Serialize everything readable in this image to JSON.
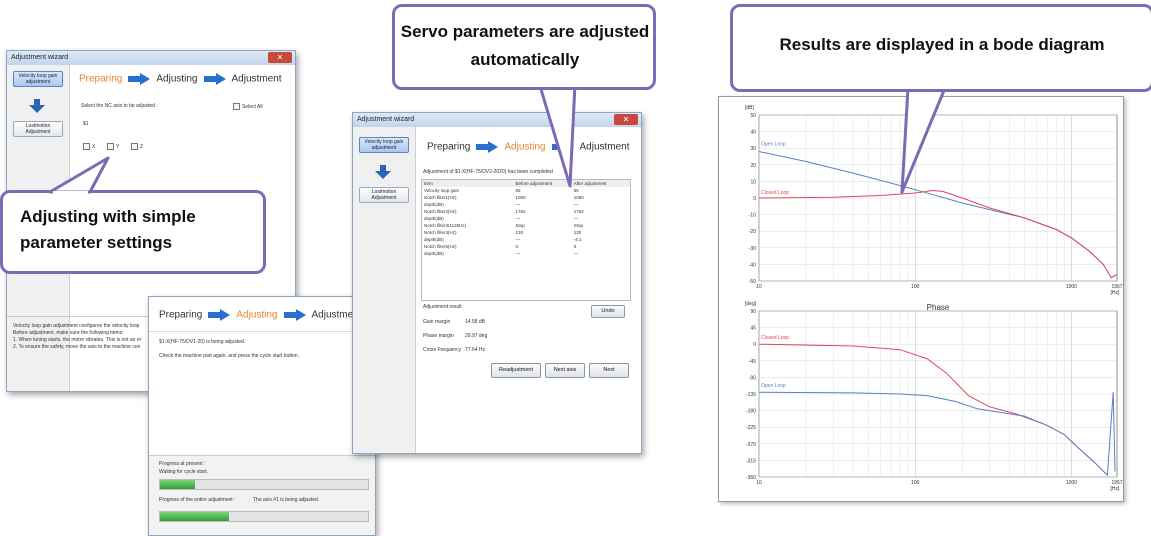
{
  "callouts": {
    "simple": "Adjusting with simple parameter settings",
    "auto": "Servo parameters are adjusted automatically",
    "bode": "Results are displayed in a bode diagram"
  },
  "steps": {
    "preparing": "Preparing",
    "adjusting": "Adjusting",
    "adjustment": "Adjustment"
  },
  "win1": {
    "title": "Adjustment wizard",
    "nav_velocity": "Velocity loop gain adjustment",
    "nav_lost": "Lostmotion Adjustment",
    "select_label": "Select the NC axis to be adjusted.",
    "select_all": "Select All",
    "system": "$1",
    "axes": [
      "X",
      "Y",
      "Z"
    ],
    "footer_lines": [
      "Velocity loop gain adjustment configures the velocity loop",
      "Before adjustment, make sure the following items:",
      "1. When tuning starts, the motor vibrates. This is not an er",
      "2. To ensure the safety, move the axis to the machine cen"
    ]
  },
  "win2": {
    "status": "$1:X(HF-75/DV1-20) is being adjusted.",
    "instruction": "Check the machine part again, and press the cycle start button.",
    "progress_label": "Progress at present :",
    "progress_status": "Waiting for cycle start.",
    "progress_present": 0.17,
    "progress_entire_label": "Progress of the entire adjustment :",
    "progress_entire_status": "The axis #1 is being adjusted.",
    "progress_entire": 0.33
  },
  "win3": {
    "title": "Adjustment wizard",
    "nav_velocity": "Velocity loop gain adjustment",
    "nav_lost": "Lostmotion Adjustment",
    "completed": "Adjustment of $1:X(HF-75/DV2-2020) has been completed",
    "columns": [
      "Item",
      "Before adjustment",
      "After adjustment"
    ],
    "rows": [
      [
        "Velocity loop gain",
        "65",
        "65"
      ],
      [
        "Notch filter1(Hz)",
        "1050",
        "1050"
      ],
      [
        "  depth(dB)",
        "—",
        "—"
      ],
      [
        "Notch filter2(Hz)",
        "1762",
        "1762"
      ],
      [
        "  depth(dB)",
        "—",
        "—"
      ],
      [
        "Notch filter3(1125Hz)",
        "Stop",
        "Stop"
      ],
      [
        "Notch filter4(Hz)",
        "130",
        "130"
      ],
      [
        "  depth(dB)",
        "—",
        "-4.1"
      ],
      [
        "Notch filter5(Hz)",
        "0",
        "0"
      ],
      [
        "  depth(dB)",
        "—",
        "—"
      ]
    ],
    "result_title": "Adjustment result",
    "undo": "Undo",
    "gain_margin_label": "Gain margin",
    "gain_margin": "14.58 dB",
    "phase_margin_label": "Phase margin",
    "phase_margin": "29.97 deg",
    "cross_label": "Cross Frequency",
    "cross_value": "77.64 Hz",
    "btn_readjust": "Readjustment",
    "btn_nextaxis": "Next axis",
    "btn_next": "Next"
  },
  "bode": {
    "gain_unit": "[dB]",
    "gain_ticks": [
      "50",
      "40",
      "30",
      "20",
      "10",
      "0",
      "-10",
      "-20",
      "-30",
      "-40",
      "-50"
    ],
    "phase_unit": "[deg]",
    "phase_title": "Phase",
    "phase_ticks": [
      "90",
      "45",
      "0",
      "-45",
      "-90",
      "-135",
      "-180",
      "-225",
      "-270",
      "-315",
      "-360"
    ],
    "x_ticks": [
      "10",
      "100",
      "1000",
      "1957"
    ],
    "x_unit": "[Hz]",
    "open_loop": "Open Loop",
    "closed_loop": "Closed Loop",
    "color_open": "#5b7fc4",
    "color_closed": "#e0475a"
  }
}
